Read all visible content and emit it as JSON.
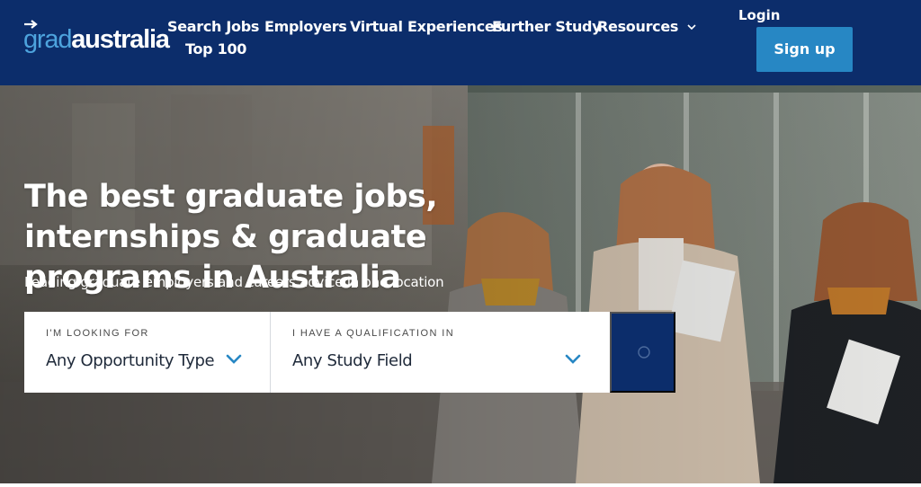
{
  "brand": {
    "logo_part1": "grad",
    "logo_part2": "australia",
    "primary_color": "#0c2d6b",
    "accent_color": "#2787c4",
    "logo_accent_color": "#4da3dd"
  },
  "nav": {
    "items": [
      "Search Jobs",
      "Employers",
      "Virtual Experiences",
      "Further Study",
      "Resources",
      "Top 100"
    ],
    "resources_icon": "chevron-down-icon"
  },
  "auth": {
    "login_label": "Login",
    "signup_label": "Sign up"
  },
  "hero": {
    "title": "The best graduate jobs, internships & graduate programs in Australia",
    "subtitle": "Leading graduate employers and careers advice in one location"
  },
  "search": {
    "opportunity": {
      "label": "I'M LOOKING FOR",
      "value": "Any Opportunity Type",
      "icon": "chevron-down-icon"
    },
    "qualification": {
      "label": "I HAVE A QUALIFICATION IN",
      "value": "Any Study Field",
      "icon": "chevron-down-icon"
    },
    "submit_icon": "search-icon"
  }
}
